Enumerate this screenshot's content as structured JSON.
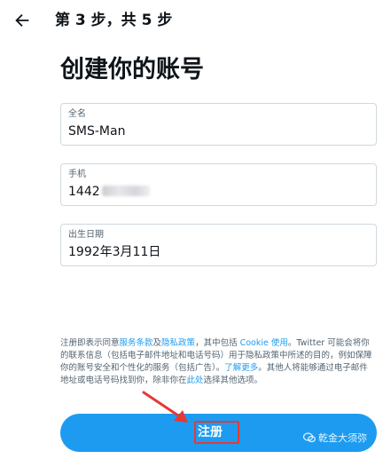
{
  "header": {
    "step_text": "第 3 步，共 5 步"
  },
  "page": {
    "title": "创建你的账号"
  },
  "form": {
    "name": {
      "label": "全名",
      "value": "SMS-Man"
    },
    "phone": {
      "label": "手机",
      "value": "1442"
    },
    "birthday": {
      "label": "出生日期",
      "value": "1992年3月11日"
    }
  },
  "disclaimer": {
    "t1": "注册即表示同意",
    "terms_link": "服务条款",
    "t2": "及",
    "privacy_link": "隐私政策",
    "t3": "，其中包括 ",
    "cookie_link": "Cookie 使用",
    "t4": "。Twitter 可能会将你的联系信息（包括电子邮件地址和电话号码）用于隐私政策中所述的目的，例如保障你的账号安全和个性化的服务（包括广告）。",
    "learn_more_link": "了解更多",
    "t5": "。其他人将能够通过电子邮件地址或电话号码找到你，除非你在",
    "here_link": "此处",
    "t6": "选择其他选项。"
  },
  "signup_button": {
    "label": "注册"
  },
  "watermark": {
    "text": "乾金大须弥"
  },
  "colors": {
    "accent": "#1d9bf0",
    "annotation_red": "#e53935"
  }
}
